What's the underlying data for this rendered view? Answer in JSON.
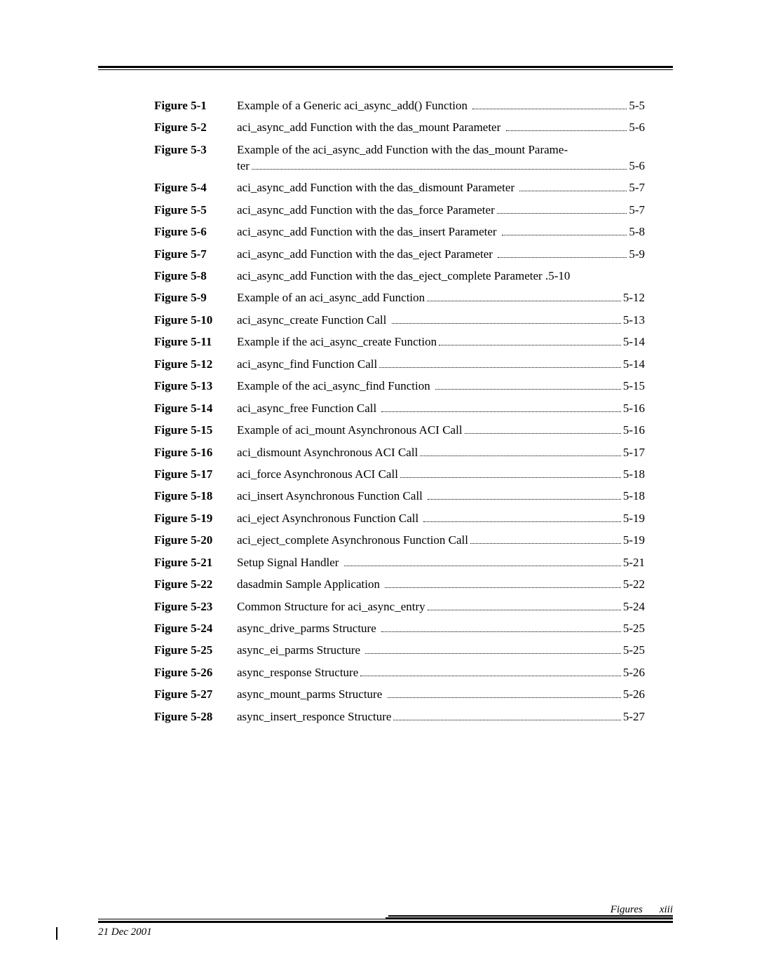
{
  "footer": {
    "date": "21 Dec 2001",
    "section": "Figures",
    "page_roman": "xiii"
  },
  "entries": [
    {
      "label": "Figure 5-1",
      "title": "Example of a Generic aci_async_add() Function ",
      "page": "5-5"
    },
    {
      "label": "Figure 5-2",
      "title": "aci_async_add Function with the das_mount Parameter ",
      "page": "5-6"
    },
    {
      "label": "Figure 5-3",
      "title_line1": "Example of the aci_async_add Function with the das_mount Parame-",
      "title_line2": "ter",
      "page": "5-6",
      "wrap": true
    },
    {
      "label": "Figure 5-4",
      "title": "aci_async_add Function with the das_dismount Parameter ",
      "page": "5-7"
    },
    {
      "label": "Figure 5-5",
      "title": "aci_async_add Function with the das_force Parameter",
      "page": "5-7"
    },
    {
      "label": "Figure 5-6",
      "title": "aci_async_add Function with the das_insert Parameter ",
      "page": "5-8"
    },
    {
      "label": "Figure 5-7",
      "title": "aci_async_add Function with the das_eject Parameter ",
      "page": "5-9"
    },
    {
      "label": "Figure 5-8",
      "title": "aci_async_add Function with the das_eject_complete Parameter ",
      "page": "5-10",
      "nodots": true
    },
    {
      "label": "Figure 5-9",
      "title": "Example of an aci_async_add Function",
      "page": "5-12"
    },
    {
      "label": "Figure 5-10",
      "title": "aci_async_create Function Call ",
      "page": "5-13"
    },
    {
      "label": "Figure 5-11",
      "title": "Example if the aci_async_create Function",
      "page": "5-14"
    },
    {
      "label": "Figure 5-12",
      "title": "aci_async_find Function Call",
      "page": "5-14"
    },
    {
      "label": "Figure 5-13",
      "title": "Example of the aci_async_find Function ",
      "page": "5-15"
    },
    {
      "label": "Figure 5-14",
      "title": "aci_async_free Function Call ",
      "page": "5-16"
    },
    {
      "label": "Figure 5-15",
      "title": "Example of aci_mount Asynchronous ACI Call",
      "page": "5-16"
    },
    {
      "label": "Figure 5-16",
      "title": "aci_dismount Asynchronous ACI Call",
      "page": "5-17"
    },
    {
      "label": "Figure 5-17",
      "title": "aci_force Asynchronous ACI Call",
      "page": "5-18"
    },
    {
      "label": "Figure 5-18",
      "title": "aci_insert Asynchronous Function Call ",
      "page": "5-18"
    },
    {
      "label": "Figure 5-19",
      "title": "aci_eject Asynchronous Function Call ",
      "page": "5-19"
    },
    {
      "label": "Figure 5-20",
      "title": "aci_eject_complete Asynchronous Function Call",
      "page": "5-19"
    },
    {
      "label": "Figure 5-21",
      "title": "Setup Signal Handler ",
      "page": "5-21"
    },
    {
      "label": "Figure 5-22",
      "title": "dasadmin Sample Application ",
      "page": "5-22"
    },
    {
      "label": "Figure 5-23",
      "title": "Common Structure for aci_async_entry",
      "page": "5-24"
    },
    {
      "label": "Figure 5-24",
      "title": "async_drive_parms Structure ",
      "page": "5-25"
    },
    {
      "label": "Figure 5-25",
      "title": "async_ei_parms Structure ",
      "page": "5-25"
    },
    {
      "label": "Figure 5-26",
      "title": "async_response Structure",
      "page": "5-26"
    },
    {
      "label": "Figure 5-27",
      "title": "async_mount_parms Structure ",
      "page": "5-26"
    },
    {
      "label": "Figure 5-28",
      "title": "async_insert_responce Structure",
      "page": "5-27"
    }
  ]
}
